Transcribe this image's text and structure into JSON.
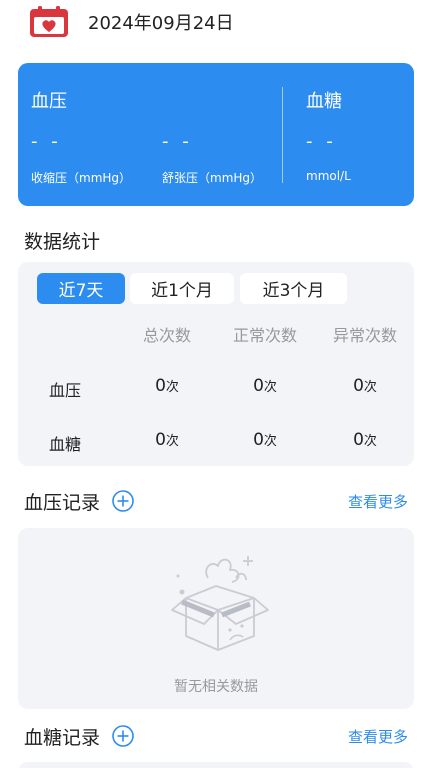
{
  "header": {
    "date": "2024年09月24日",
    "calendar_icon": "calendar-heart-icon",
    "accent_color": "#2d8cf0"
  },
  "summary_card": {
    "blood_pressure_title": "血压",
    "systolic_value": "- -",
    "systolic_label": "收缩压（mmHg）",
    "diastolic_value": "- -",
    "diastolic_label": "舒张压（mmHg）",
    "blood_sugar_title": "血糖",
    "sugar_value": "- -",
    "sugar_label": "mmol/L"
  },
  "stats": {
    "title": "数据统计",
    "tabs": [
      {
        "label": "近7天",
        "active": true
      },
      {
        "label": "近1个月",
        "active": false
      },
      {
        "label": "近3个月",
        "active": false
      }
    ],
    "columns": [
      "总次数",
      "正常次数",
      "异常次数"
    ],
    "rows": [
      {
        "label": "血压",
        "values": [
          "0",
          "0",
          "0"
        ],
        "unit": "次"
      },
      {
        "label": "血糖",
        "values": [
          "0",
          "0",
          "0"
        ],
        "unit": "次"
      }
    ]
  },
  "bp_records": {
    "title": "血压记录",
    "more_label": "查看更多",
    "empty_text": "暂无相关数据"
  },
  "bs_records": {
    "title": "血糖记录",
    "more_label": "查看更多"
  }
}
